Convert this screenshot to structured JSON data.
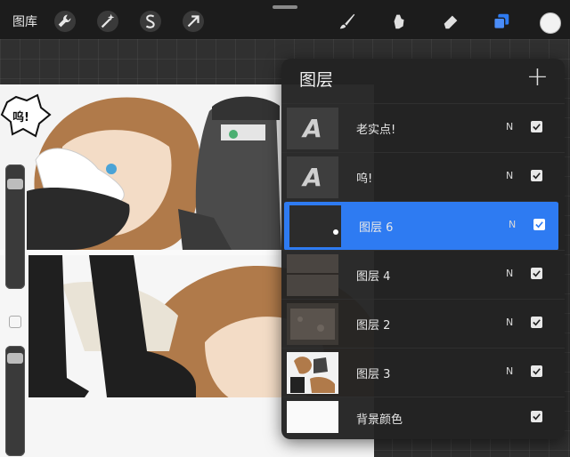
{
  "toolbar": {
    "gallery_label": "图库",
    "left_icons": [
      "wrench-icon",
      "magic-wand-icon",
      "selection-s-icon",
      "transform-arrow-icon"
    ],
    "right_icons": [
      "brush-icon",
      "smudge-icon",
      "eraser-icon",
      "layers-icon"
    ],
    "current_color": "#f2f2f2",
    "accent_color": "#2e7bf2"
  },
  "layers_panel": {
    "title": "图层",
    "add_label": "+",
    "layers": [
      {
        "name": "老实点!",
        "thumb": "A",
        "blend": "N",
        "visible": true,
        "selected": false
      },
      {
        "name": "呜!",
        "thumb": "A",
        "blend": "N",
        "visible": true,
        "selected": false
      },
      {
        "name": "图层 6",
        "thumb": "",
        "blend": "N",
        "visible": true,
        "selected": true
      },
      {
        "name": "图层 4",
        "thumb": "",
        "blend": "N",
        "visible": true,
        "selected": false
      },
      {
        "name": "图层 2",
        "thumb": "",
        "blend": "N",
        "visible": true,
        "selected": false
      },
      {
        "name": "图层 3",
        "thumb": "",
        "blend": "N",
        "visible": true,
        "selected": false
      },
      {
        "name": "背景颜色",
        "thumb": "",
        "blend": "",
        "visible": true,
        "selected": false
      }
    ]
  },
  "canvas": {
    "speech_text": "呜!"
  }
}
